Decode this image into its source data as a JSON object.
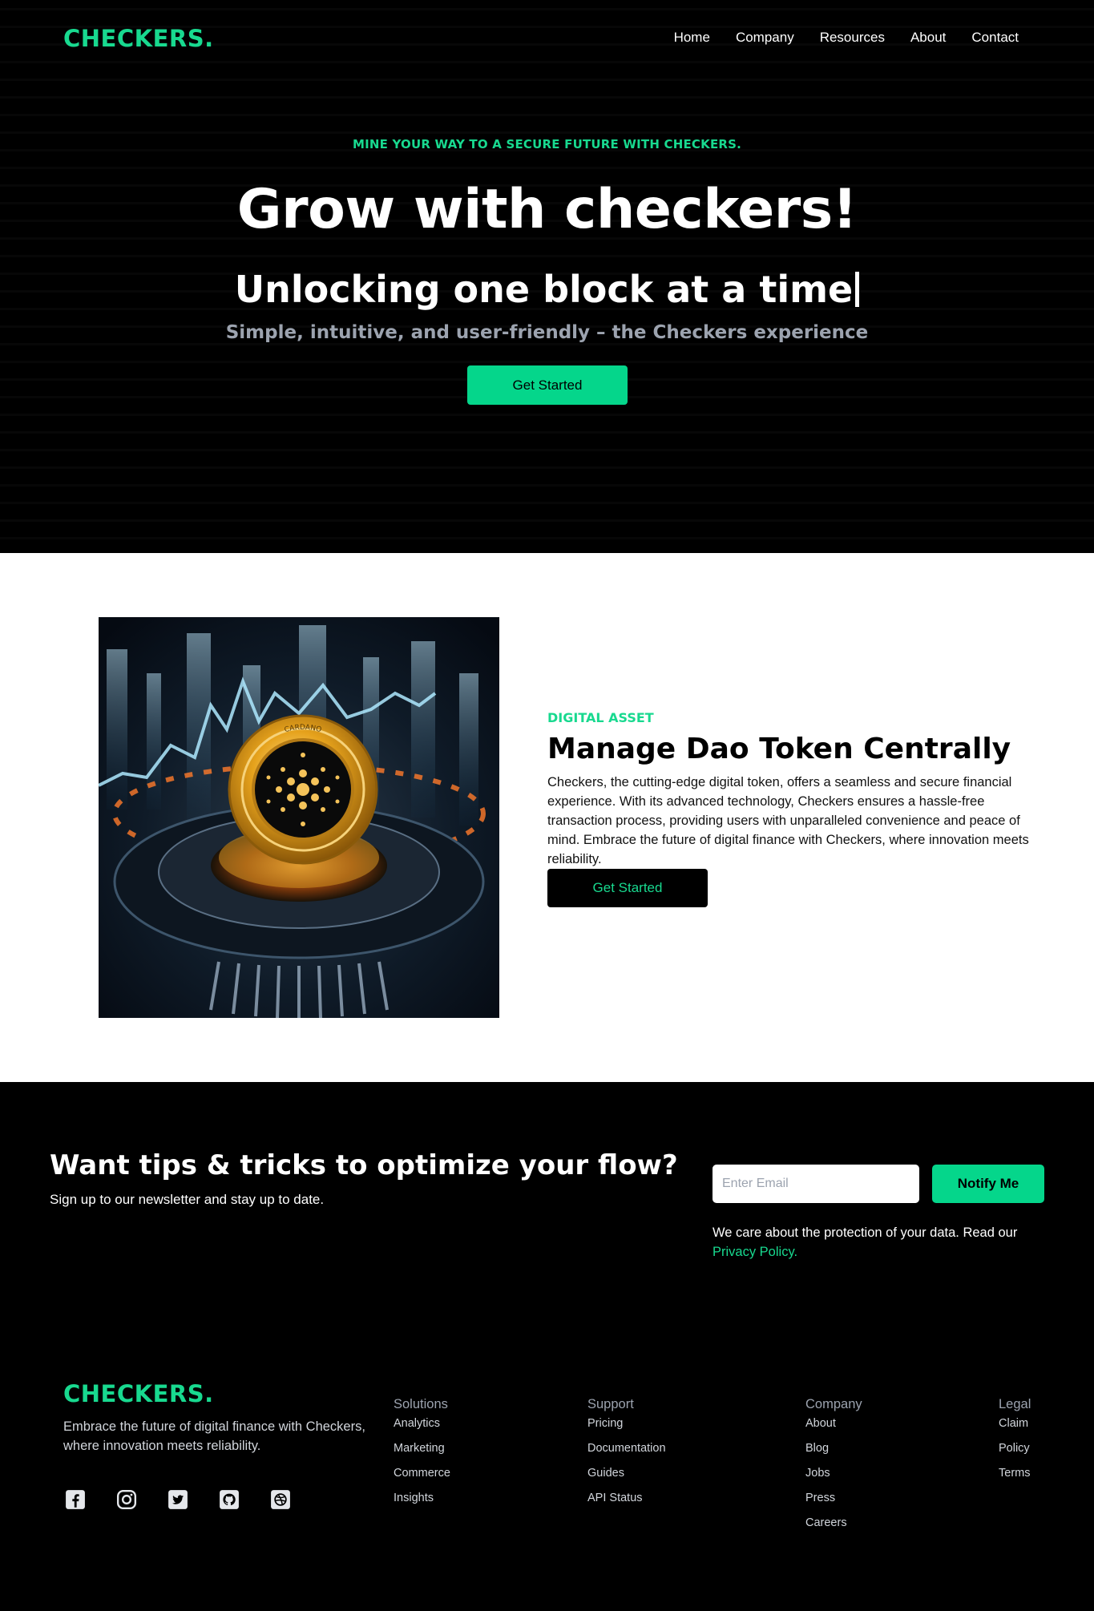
{
  "brand": {
    "name": "CHECKERS."
  },
  "nav": {
    "items": [
      {
        "label": "Home"
      },
      {
        "label": "Company"
      },
      {
        "label": "Resources"
      },
      {
        "label": "About"
      },
      {
        "label": "Contact"
      }
    ]
  },
  "hero": {
    "eyebrow": "MINE YOUR WAY TO A SECURE FUTURE WITH CHECKERS.",
    "title": "Grow with checkers!",
    "subtitle": "Unlocking one block at a time",
    "tagline": "Simple, intuitive, and user-friendly – the Checkers experience",
    "cta_label": "Get Started"
  },
  "feature": {
    "coin_label": "CARDANO",
    "eyebrow": "DIGITAL ASSET",
    "title": "Manage Dao Token Centrally",
    "body": "Checkers, the cutting-edge digital token, offers a seamless and secure financial experience. With its advanced technology, Checkers ensures a hassle-free transaction process, providing users with unparalleled convenience and peace of mind. Embrace the future of digital finance with Checkers, where innovation meets reliability.",
    "cta_label": "Get Started"
  },
  "newsletter": {
    "title": "Want tips & tricks to optimize your flow?",
    "subtitle": "Sign up to our newsletter and stay up to date.",
    "email_placeholder": "Enter Email",
    "email_value": "",
    "button_label": "Notify Me",
    "note": "We care about the protection of your data. Read our",
    "privacy_link": "Privacy Policy."
  },
  "footer": {
    "brand": "CHECKERS.",
    "blurb": "Embrace the future of digital finance with Checkers, where innovation meets reliability.",
    "socials": [
      {
        "icon": "facebook-icon"
      },
      {
        "icon": "instagram-icon"
      },
      {
        "icon": "twitter-icon"
      },
      {
        "icon": "github-icon"
      },
      {
        "icon": "dribbble-icon"
      }
    ],
    "columns": [
      {
        "heading": "Solutions",
        "links": [
          "Analytics",
          "Marketing",
          "Commerce",
          "Insights"
        ]
      },
      {
        "heading": "Support",
        "links": [
          "Pricing",
          "Documentation",
          "Guides",
          "API Status"
        ]
      },
      {
        "heading": "Company",
        "links": [
          "About",
          "Blog",
          "Jobs",
          "Press",
          "Careers"
        ]
      },
      {
        "heading": "Legal",
        "links": [
          "Claim",
          "Policy",
          "Terms"
        ]
      }
    ]
  },
  "colors": {
    "accent": "#18d98f",
    "button_green": "#05d68b",
    "background": "#000000",
    "muted_text": "#9ca3af"
  }
}
